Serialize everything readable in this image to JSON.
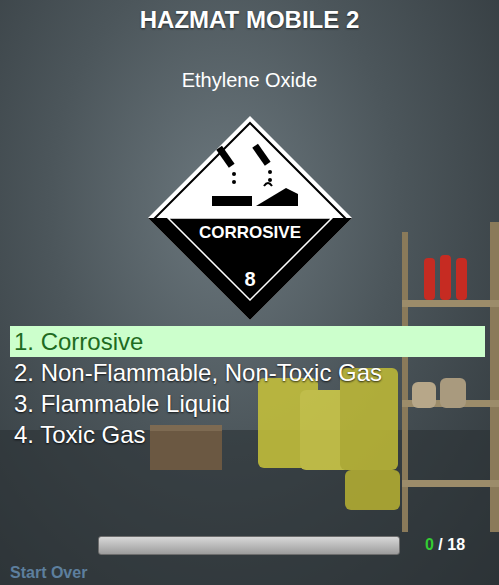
{
  "title": "HAZMAT MOBILE 2",
  "question": {
    "substance": "Ethylene Oxide"
  },
  "placard": {
    "label": "CORROSIVE",
    "class": "8"
  },
  "options": [
    {
      "label": "1. Corrosive",
      "selected": true
    },
    {
      "label": "2. Non-Flammable, Non-Toxic Gas",
      "selected": false
    },
    {
      "label": "3. Flammable Liquid",
      "selected": false
    },
    {
      "label": "4. Toxic Gas",
      "selected": false
    }
  ],
  "progress": {
    "level": 0,
    "correct": "0",
    "total": "/ 18"
  },
  "footer": {
    "start_over": "Start Over"
  }
}
